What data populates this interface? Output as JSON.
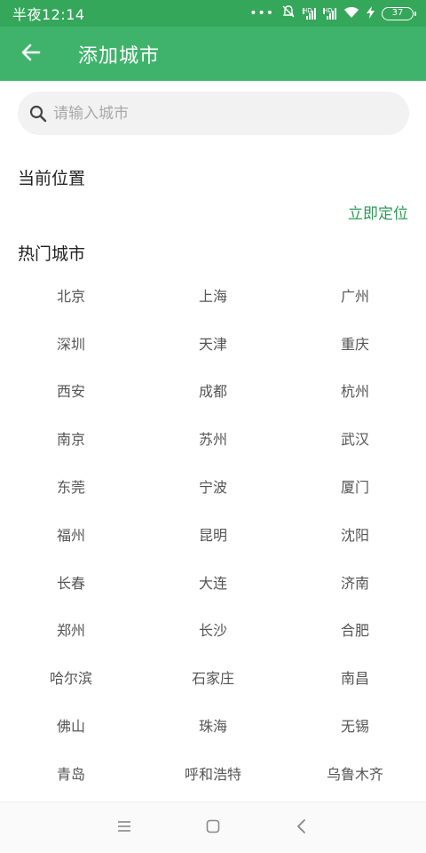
{
  "status_bar": {
    "time": "半夜12:14",
    "dots": "•••",
    "battery": "37"
  },
  "header": {
    "title": "添加城市",
    "back_icon": "arrow-left-icon"
  },
  "search": {
    "placeholder": "请输入城市",
    "value": "",
    "icon": "search-icon"
  },
  "current_location": {
    "heading": "当前位置",
    "action": "立即定位"
  },
  "hot_cities": {
    "heading": "热门城市",
    "cities": [
      "北京",
      "上海",
      "广州",
      "深圳",
      "天津",
      "重庆",
      "西安",
      "成都",
      "杭州",
      "南京",
      "苏州",
      "武汉",
      "东莞",
      "宁波",
      "厦门",
      "福州",
      "昆明",
      "沈阳",
      "长春",
      "大连",
      "济南",
      "郑州",
      "长沙",
      "合肥",
      "哈尔滨",
      "石家庄",
      "南昌",
      "佛山",
      "珠海",
      "无锡",
      "青岛",
      "呼和浩特",
      "乌鲁木齐"
    ]
  },
  "colors": {
    "status_bar": "#35a75a",
    "app_bar": "#3fb36c",
    "accent_link": "#2e9a55",
    "search_bg": "#f2f2f2"
  },
  "nav_bar": {
    "icons": [
      "menu-icon",
      "home-square-icon",
      "back-chevron-icon"
    ]
  }
}
